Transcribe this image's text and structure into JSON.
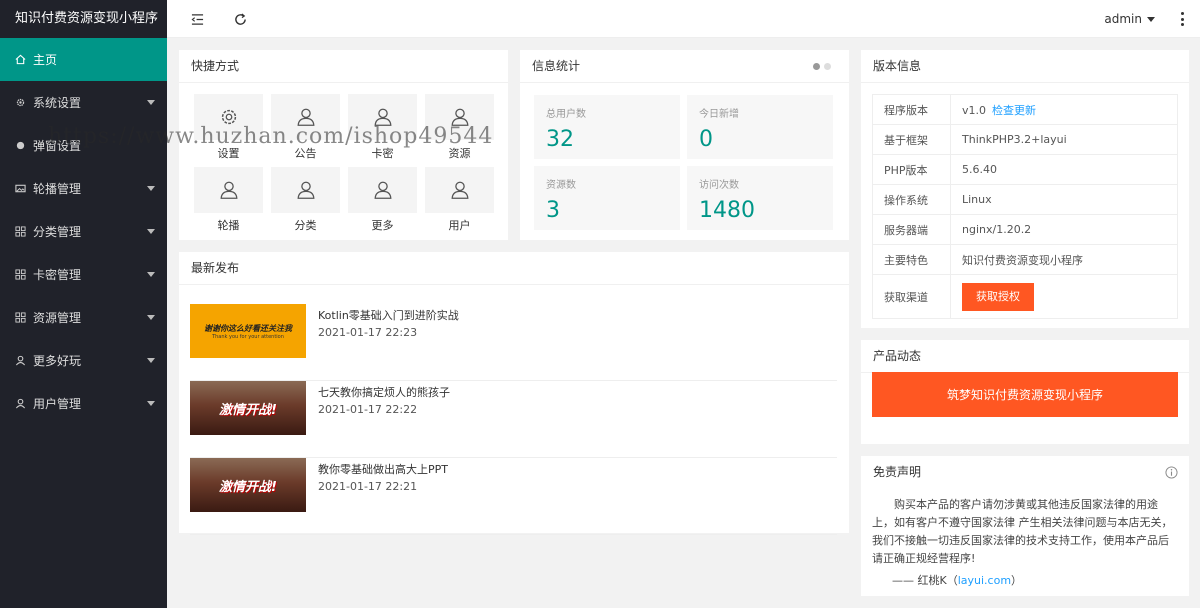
{
  "app": {
    "title": "知识付费资源变现小程序"
  },
  "sidebar": {
    "items": [
      {
        "label": "主页",
        "icon": "home-icon",
        "active": true,
        "expandable": false
      },
      {
        "label": "系统设置",
        "icon": "gear-icon",
        "active": false,
        "expandable": true
      },
      {
        "label": "弹窗设置",
        "icon": "dot-icon",
        "active": false,
        "expandable": false
      },
      {
        "label": "轮播管理",
        "icon": "image-icon",
        "active": false,
        "expandable": true
      },
      {
        "label": "分类管理",
        "icon": "grid-icon",
        "active": false,
        "expandable": true
      },
      {
        "label": "卡密管理",
        "icon": "grid-icon",
        "active": false,
        "expandable": true
      },
      {
        "label": "资源管理",
        "icon": "grid-icon",
        "active": false,
        "expandable": true
      },
      {
        "label": "更多好玩",
        "icon": "user-icon",
        "active": false,
        "expandable": true
      },
      {
        "label": "用户管理",
        "icon": "user-icon",
        "active": false,
        "expandable": true
      }
    ]
  },
  "header": {
    "user": "admin"
  },
  "quick": {
    "title": "快捷方式",
    "tiles": [
      {
        "label": "设置",
        "icon": "gear-icon"
      },
      {
        "label": "公告",
        "icon": "user-icon"
      },
      {
        "label": "卡密",
        "icon": "user-icon"
      },
      {
        "label": "资源",
        "icon": "user-icon"
      },
      {
        "label": "轮播",
        "icon": "user-icon"
      },
      {
        "label": "分类",
        "icon": "user-icon"
      },
      {
        "label": "更多",
        "icon": "user-icon"
      },
      {
        "label": "用户",
        "icon": "user-icon"
      }
    ]
  },
  "stats": {
    "title": "信息统计",
    "items": [
      {
        "label": "总用户数",
        "value": "32"
      },
      {
        "label": "今日新增",
        "value": "0"
      },
      {
        "label": "资源数",
        "value": "3"
      },
      {
        "label": "访问次数",
        "value": "1480"
      }
    ]
  },
  "latest": {
    "title": "最新发布",
    "posts": [
      {
        "title": "Kotlin零基础入门到进阶实战",
        "date": "2021-01-17 22:23",
        "thumb_text": "谢谢你这么好看还关注我",
        "thumb_sub": "Thank you for your attention"
      },
      {
        "title": "七天教你搞定烦人的熊孩子",
        "date": "2021-01-17 22:22",
        "thumb_text": "激情开战!",
        "thumb_sub": ""
      },
      {
        "title": "教你零基础做出高大上PPT",
        "date": "2021-01-17 22:21",
        "thumb_text": "激情开战!",
        "thumb_sub": ""
      }
    ]
  },
  "version": {
    "title": "版本信息",
    "rows": [
      {
        "key": "程序版本",
        "value": "v1.0",
        "link": "检查更新"
      },
      {
        "key": "基于框架",
        "value": "ThinkPHP3.2+layui"
      },
      {
        "key": "PHP版本",
        "value": "5.6.40"
      },
      {
        "key": "操作系统",
        "value": "Linux"
      },
      {
        "key": "服务器端",
        "value": "nginx/1.20.2"
      },
      {
        "key": "主要特色",
        "value": "知识付费资源变现小程序"
      }
    ],
    "channel_key": "获取渠道",
    "channel_button": "获取授权"
  },
  "product": {
    "title": "产品动态",
    "button": "筑梦知识付费资源变现小程序"
  },
  "disclaimer": {
    "title": "免责声明",
    "text": "购买本产品的客户请勿涉黄或其他违反国家法律的用途上，如有客户不遵守国家法律 产生相关法律问题与本店无关，我们不接触一切违反国家法律的技术支持工作，使用本产品后请正确正规经营程序!",
    "sign_prefix": "—— 红桃K（",
    "sign_link": "layui.com",
    "sign_suffix": "）"
  },
  "watermark": "https://www.huzhan.com/ishop49544",
  "colors": {
    "accent": "#009688",
    "orange": "#ff5722",
    "link": "#1e9fff",
    "sidebar": "#20222a"
  }
}
